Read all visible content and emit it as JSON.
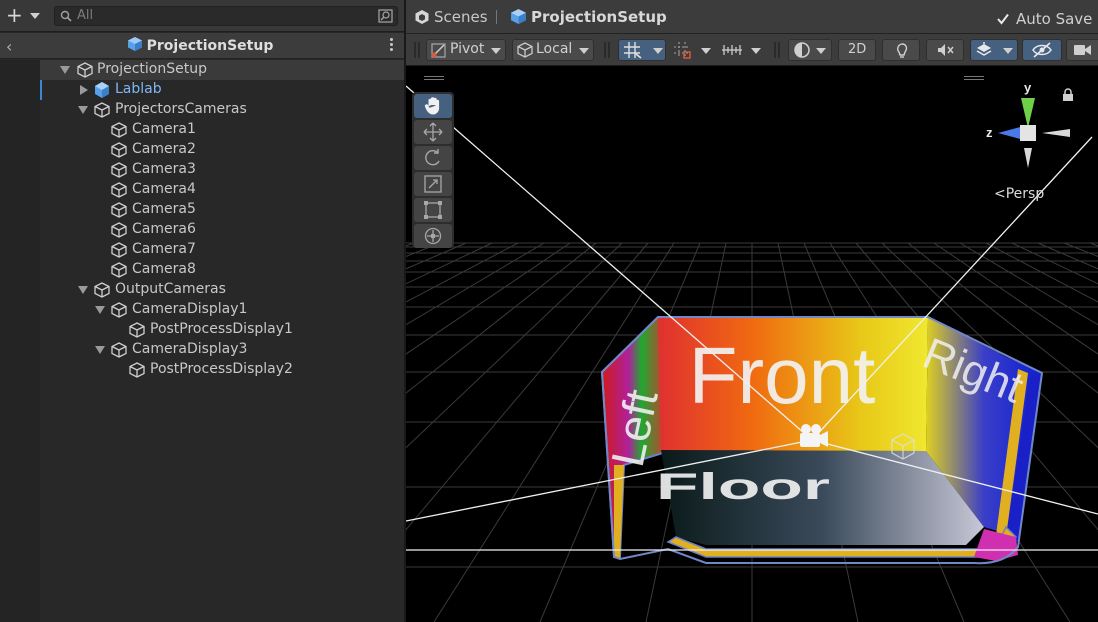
{
  "hierarchy": {
    "search_placeholder": "All",
    "title": "ProjectionSetup",
    "items": [
      {
        "label": "ProjectionSetup"
      },
      {
        "label": "Lablab"
      },
      {
        "label": "ProjectorsCameras"
      },
      {
        "label": "Camera1"
      },
      {
        "label": "Camera2"
      },
      {
        "label": "Camera3"
      },
      {
        "label": "Camera4"
      },
      {
        "label": "Camera5"
      },
      {
        "label": "Camera6"
      },
      {
        "label": "Camera7"
      },
      {
        "label": "Camera8"
      },
      {
        "label": "OutputCameras"
      },
      {
        "label": "CameraDisplay1"
      },
      {
        "label": "PostProcessDisplay1"
      },
      {
        "label": "CameraDisplay3"
      },
      {
        "label": "PostProcessDisplay2"
      }
    ]
  },
  "scene": {
    "tabs": [
      {
        "label": "Scenes"
      },
      {
        "label": "ProjectionSetup"
      }
    ],
    "auto_save_label": "Auto Save",
    "auto_save_checked": true,
    "toolbar": {
      "pivot_label": "Pivot",
      "local_label": "Local",
      "mode_2d_label": "2D"
    },
    "gizmo": {
      "y_label": "y",
      "z_label": "z",
      "projection_label": "Persp"
    },
    "room": {
      "front_text": "Front",
      "left_text": "Left",
      "right_text": "Right",
      "floor_text": "Floor"
    }
  },
  "colors": {
    "accent": "#46607f",
    "prefab_blue": "#7eb6f5",
    "panel_bg": "#282828",
    "toolbar_bg": "#3c3c3c"
  }
}
